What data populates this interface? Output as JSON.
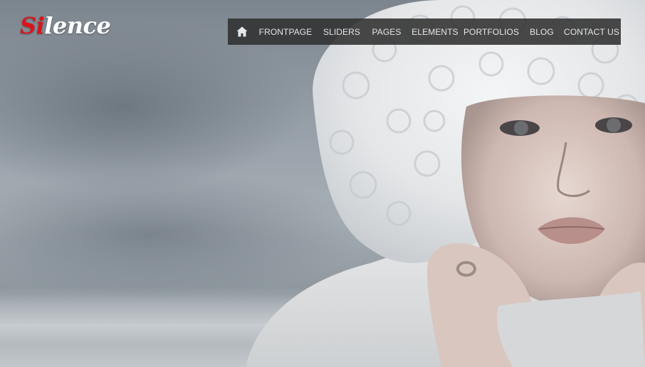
{
  "logo": {
    "accent_text": "Si",
    "text": "lence"
  },
  "nav": {
    "home_icon": "home-icon",
    "items": [
      {
        "label": "FRONTPAGE"
      },
      {
        "label": "SLIDERS"
      },
      {
        "label": "PAGES"
      },
      {
        "label": "ELEMENTS"
      },
      {
        "label": "PORTFOLIOS"
      },
      {
        "label": "BLOG"
      },
      {
        "label": "CONTACT US"
      }
    ]
  },
  "colors": {
    "accent": "#d8151c",
    "nav_bg": "#303030",
    "nav_text": "#e6e6e6"
  }
}
